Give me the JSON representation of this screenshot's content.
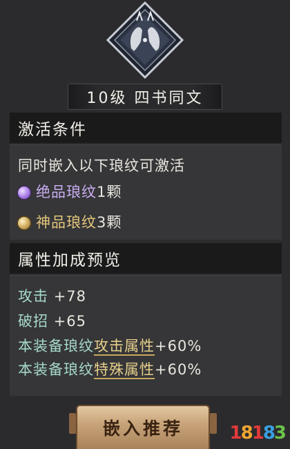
{
  "emblem": {
    "icon": "twin-beast-diamond-emblem"
  },
  "banner": {
    "level_title": "10级 四书同文"
  },
  "activation": {
    "header": "激活条件",
    "intro": "同时嵌入以下琅纹可激活",
    "requirements": [
      {
        "icon": "purple-gem",
        "name": "绝品琅纹",
        "count": "1颗",
        "color": "#c9aef2"
      },
      {
        "icon": "gold-gem",
        "name": "神品琅纹",
        "count": "3颗",
        "color": "#e4c77c"
      }
    ]
  },
  "preview": {
    "header": "属性加成预览",
    "stats": [
      {
        "label": "攻击",
        "value": "+78"
      },
      {
        "label": "破招",
        "value": "+65"
      }
    ],
    "bonuses": [
      {
        "prefix": "本装备琅纹",
        "attr": "攻击属性",
        "value": "+60%"
      },
      {
        "prefix": "本装备琅纹",
        "attr": "特殊属性",
        "value": "+60%"
      }
    ]
  },
  "button": {
    "label": "嵌入推荐"
  },
  "watermark": {
    "chars": [
      "1",
      "8",
      "1",
      "8",
      "3"
    ],
    "colors": [
      "#e23a3a",
      "#f2a531",
      "#e23a3a",
      "#3aa0e2",
      "#6cc24a"
    ]
  }
}
